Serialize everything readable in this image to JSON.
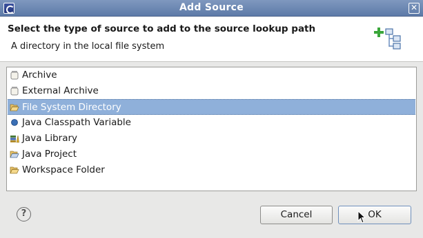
{
  "window": {
    "title": "Add Source"
  },
  "header": {
    "title": "Select the type of source to add to the source lookup path",
    "message": "A directory in the local file system"
  },
  "list": {
    "items": [
      {
        "label": "Archive",
        "icon": "jar-icon",
        "selected": false
      },
      {
        "label": "External Archive",
        "icon": "jar-icon",
        "selected": false
      },
      {
        "label": "File System Directory",
        "icon": "folder-open-icon",
        "selected": true
      },
      {
        "label": "Java Classpath Variable",
        "icon": "classpath-variable-icon",
        "selected": false
      },
      {
        "label": "Java Library",
        "icon": "library-icon",
        "selected": false
      },
      {
        "label": "Java Project",
        "icon": "project-folder-icon",
        "selected": false
      },
      {
        "label": "Workspace Folder",
        "icon": "folder-icon",
        "selected": false
      }
    ]
  },
  "buttons": {
    "help_label": "?",
    "cancel_label": "Cancel",
    "ok_label": "OK"
  },
  "colors": {
    "titlebar": "#6683b2",
    "selection": "#8fb0da",
    "accent_green": "#3aa63a"
  }
}
